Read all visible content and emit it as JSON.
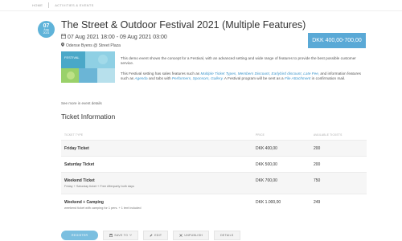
{
  "breadcrumb": {
    "home": "HOME",
    "section": "ACTIVITIES & EVENTS"
  },
  "date_badge": {
    "day": "07",
    "month": "Aug",
    "year": "2021"
  },
  "event": {
    "title": "The Street & Outdoor Festival 2021 (Multiple Features)",
    "dates": "07 Aug 2021 18:00 - 09 Aug 2021  03:00",
    "venue": "Odense Byens @ Street Plaza",
    "price": "DKK 400,00-700,00",
    "thumbnail_text": "FESTIVAL"
  },
  "description": {
    "p1": "This demo event shows the concept for a Festival, with an advanced setting and wide range of features to provide the best possible customer service.",
    "p2_a": "This Festival setting has sales features such as ",
    "p2_link1": "Multiple Ticket Types, Members Discount, Earlybird discount, Late Fee,",
    "p2_b": " and information features such as ",
    "p2_link2": "Agenda",
    "p2_c": " and tabs with ",
    "p2_link3": "Performers, Sponsors, Gallery.",
    "p2_d": " A Festival program will be sent as a ",
    "p2_link4": "File Attachment",
    "p2_e": " in confirmation mail."
  },
  "see_more": "See more in event details",
  "tickets": {
    "title": "Ticket Information",
    "headers": {
      "type": "TICKET TYPE",
      "price": "PRICE",
      "available": "AVAILABLE TICKETS"
    },
    "rows": [
      {
        "name": "Friday Ticket",
        "desc": "",
        "price": "DKK 400,00",
        "available": "200"
      },
      {
        "name": "Saturday Ticket",
        "desc": "",
        "price": "DKK 500,00",
        "available": "200"
      },
      {
        "name": "Weekend Ticket",
        "desc": "Friday + Saturday ticket + Free Afterparty both days",
        "price": "DKK 700,00",
        "available": "750"
      },
      {
        "name": "Weekend + Camping",
        "desc": "weekend ticket with camping for 1 pers. + 1 tent included",
        "price": "DKK 1.000,00",
        "available": "249"
      }
    ]
  },
  "actions": {
    "register": "REGISTER",
    "save_to": "SAVE TO",
    "edit": "EDIT",
    "unpublish": "UNPUBLISH",
    "details": "DETAILS"
  },
  "colors": {
    "accent": "#5aa9d6",
    "badge": "#5fb3d9",
    "link": "#3d96cc"
  }
}
